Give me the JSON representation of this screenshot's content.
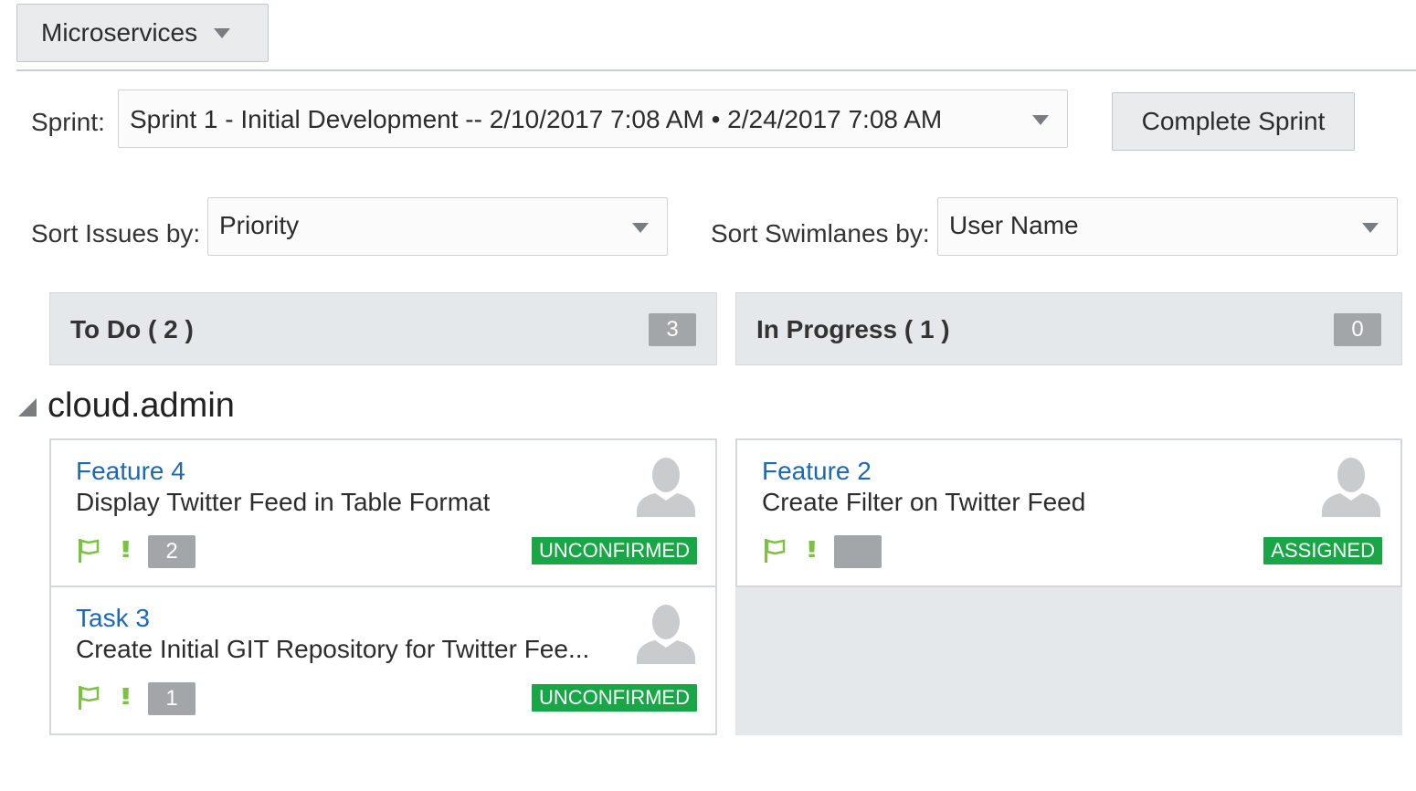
{
  "project": {
    "label": "Microservices",
    "icon": "chevron-down-icon"
  },
  "sprint": {
    "label": "Sprint:",
    "value": "Sprint 1 - Initial Development -- 2/10/2017 7:08 AM • 2/24/2017 7:08 AM",
    "complete_button": "Complete Sprint"
  },
  "sort_issues": {
    "label": "Sort Issues by:",
    "value": "Priority"
  },
  "sort_swimlanes": {
    "label": "Sort Swimlanes by:",
    "value": "User Name"
  },
  "columns": [
    {
      "title": "To Do ( 2 )",
      "count": "3"
    },
    {
      "title": "In Progress ( 1 )",
      "count": "0"
    }
  ],
  "swimlane": {
    "name": "cloud.admin"
  },
  "cards": [
    {
      "id": "Feature 4",
      "summary": "Display Twitter Feed in Table Format",
      "points": "2",
      "status": "UNCONFIRMED",
      "priority": "!!"
    },
    {
      "id": "Task 3",
      "summary": "Create Initial GIT Repository for Twitter Fee...",
      "points": "1",
      "status": "UNCONFIRMED",
      "priority": "!!"
    },
    {
      "id": "Feature 2",
      "summary": "Create Filter on Twitter Feed",
      "points": "",
      "status": "ASSIGNED",
      "priority": "!!"
    }
  ],
  "colors": {
    "link": "#1b69b6",
    "status_green": "#19a647",
    "priority_green": "#7bc142",
    "header_bg": "#e5e8eb"
  }
}
